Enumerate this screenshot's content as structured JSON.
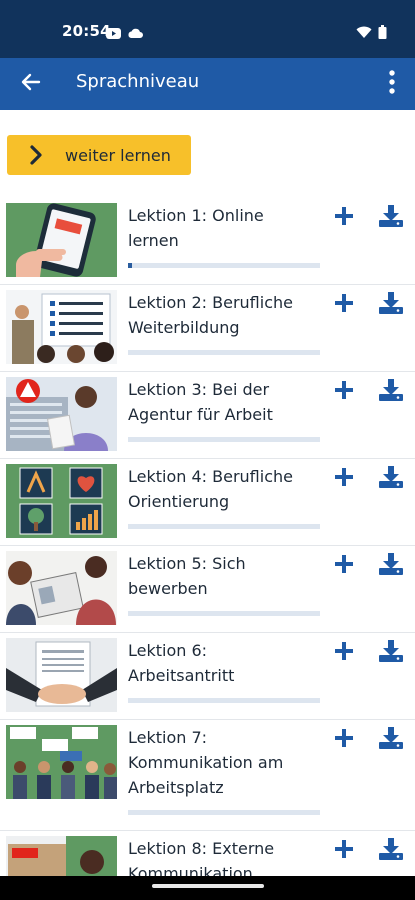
{
  "status_bar": {
    "time": "20:54"
  },
  "app_bar": {
    "title": "Sprachniveau"
  },
  "continue_button": {
    "label": "weiter lernen"
  },
  "lessons": [
    {
      "title_line1": "Lektion 1: Online",
      "title_line2": "lernen",
      "title_line3": "",
      "progress": 0.02
    },
    {
      "title_line1": "Lektion 2: Berufliche",
      "title_line2": "Weiterbildung",
      "title_line3": "",
      "progress": 0
    },
    {
      "title_line1": "Lektion 3: Bei der",
      "title_line2": "Agentur für Arbeit",
      "title_line3": "",
      "progress": 0
    },
    {
      "title_line1": "Lektion 4: Berufliche",
      "title_line2": "Orientierung",
      "title_line3": "",
      "progress": 0
    },
    {
      "title_line1": "Lektion 5: Sich",
      "title_line2": "bewerben",
      "title_line3": "",
      "progress": 0
    },
    {
      "title_line1": "Lektion 6:",
      "title_line2": "Arbeitsantritt",
      "title_line3": "",
      "progress": 0
    },
    {
      "title_line1": "Lektion 7:",
      "title_line2": "Kommunikation am",
      "title_line3": "Arbeitsplatz",
      "progress": 0
    },
    {
      "title_line1": "Lektion 8: Externe",
      "title_line2": "Kommunikation",
      "title_line3": "",
      "progress": 0
    }
  ],
  "icons": {
    "back": "arrow-left-icon",
    "menu": "more-vertical-icon",
    "continue": "chevron-right-icon",
    "add": "plus-icon",
    "download": "download-icon"
  },
  "colors": {
    "status_bar": "#11335c",
    "app_bar": "#1f5aa6",
    "accent_button": "#f7c02a",
    "icon_blue": "#1f5aa6",
    "progress_track": "#dde5ef",
    "progress_fill": "#2a5d9f"
  }
}
